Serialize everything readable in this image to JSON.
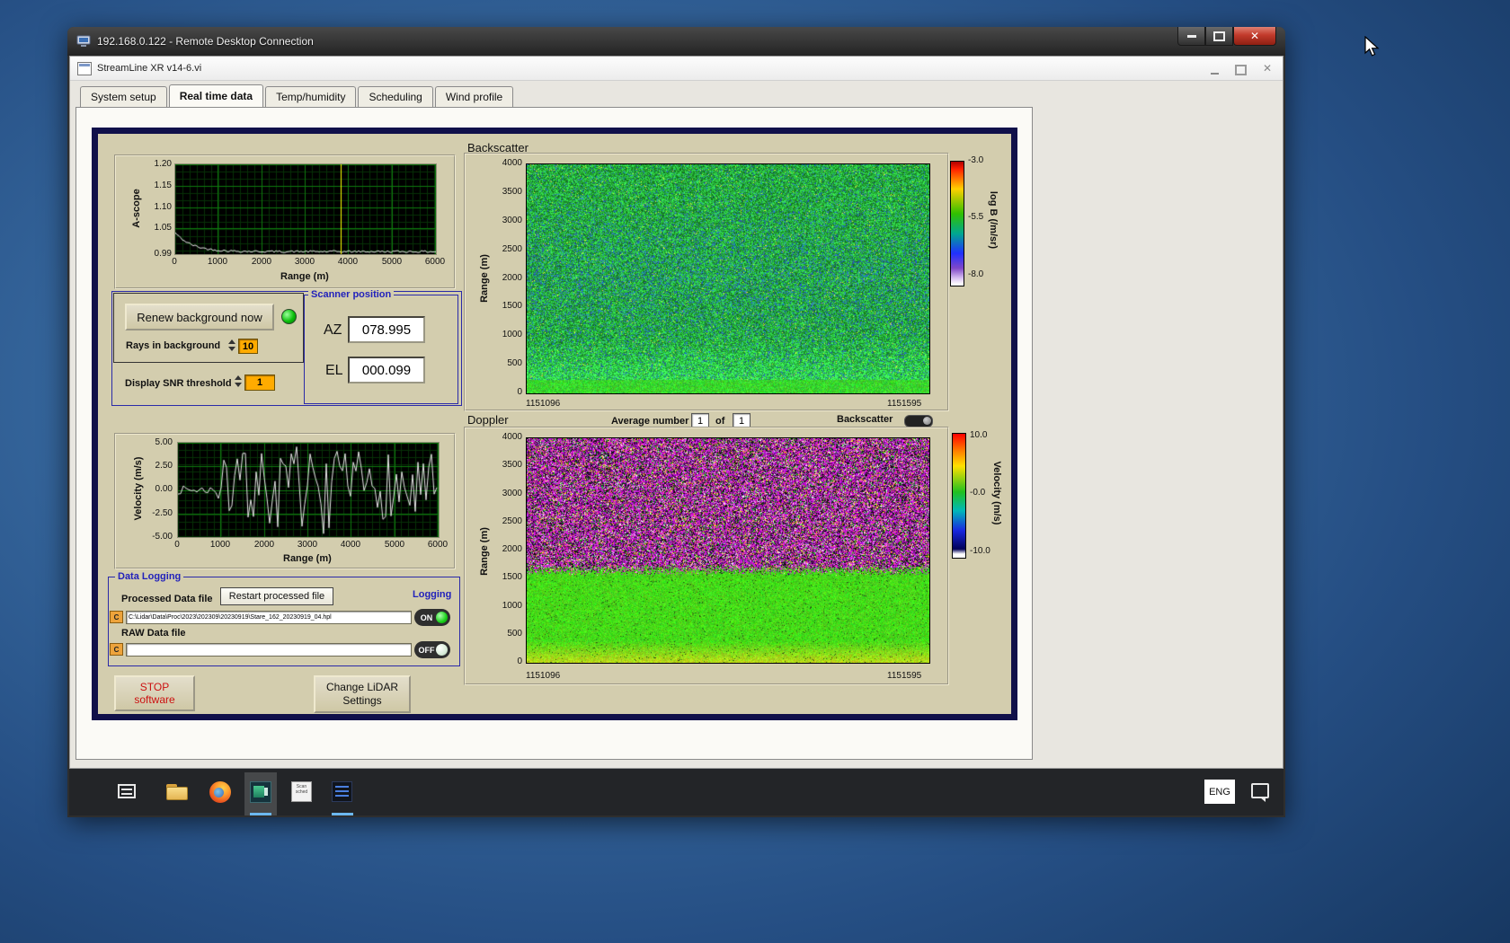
{
  "rdp": {
    "title": "192.168.0.122 - Remote Desktop Connection"
  },
  "app": {
    "title": "StreamLine XR v14-6.vi",
    "active_tab": "Real time data",
    "tabs": [
      {
        "label": "System setup"
      },
      {
        "label": "Real time data"
      },
      {
        "label": "Temp/humidity"
      },
      {
        "label": "Scheduling"
      },
      {
        "label": "Wind profile"
      }
    ]
  },
  "panel": {
    "controls": {
      "renew_button": "Renew background now",
      "rays_label": "Rays in background",
      "rays_value": "10",
      "snr_label": "Display SNR threshold",
      "snr_value": "1"
    },
    "scanner": {
      "title": "Scanner position",
      "az_label": "AZ",
      "az_value": "078.995",
      "el_label": "EL",
      "el_value": "000.099"
    },
    "doppler_bar": {
      "average_label": "Average number",
      "average_value": "1",
      "of_label": "of",
      "total_value": "1",
      "toggle_label": "Backscatter"
    },
    "logging": {
      "title": "Data Logging",
      "processed_label": "Processed Data file",
      "restart_button": "Restart processed file",
      "logging_label": "Logging",
      "drive_letter": "C",
      "processed_path": "C:\\Lidar\\Data\\Proc\\2023\\202309\\20230919\\Stare_162_20230919_04.hpl",
      "processed_toggle": "ON",
      "raw_label": "RAW Data file",
      "raw_path": "",
      "raw_toggle": "OFF"
    },
    "stop_button_line1": "STOP",
    "stop_button_line2": "software",
    "change_button_line1": "Change LiDAR",
    "change_button_line2": "Settings"
  },
  "taskbar": {
    "language": "ENG",
    "icons": [
      "task-view-icon",
      "file-explorer-icon",
      "firefox-icon",
      "remote-app-icon",
      "scan-scheduler-icon",
      "document-list-icon",
      "language-indicator",
      "notification-icon"
    ]
  },
  "chart_data": [
    {
      "id": "ascope",
      "type": "line",
      "ylabel": "A-scope",
      "xlabel": "Range (m)",
      "xlim": [
        0,
        6000
      ],
      "ylim": [
        0.99,
        1.2
      ],
      "xticks": [
        "0",
        "1000",
        "2000",
        "3000",
        "4000",
        "5000",
        "6000"
      ],
      "yticks": [
        "1.20",
        "1.15",
        "1.10",
        "1.05",
        "0.99"
      ],
      "cursor_x": 3800,
      "description": "white intensity trace decaying from ~1.04 at range 0 to flat ~0.995; yellow cursor line near 3800 m; dense green grid on black"
    },
    {
      "id": "velocity",
      "type": "line",
      "ylabel": "Velocity (m/s)",
      "xlabel": "Range (m)",
      "xlim": [
        0,
        6000
      ],
      "ylim": [
        -5,
        5
      ],
      "xticks": [
        "0",
        "1000",
        "2000",
        "3000",
        "4000",
        "5000",
        "6000"
      ],
      "yticks": [
        "5.00",
        "2.50",
        "0.00",
        "-2.50",
        "-5.00"
      ],
      "description": "near-zero velocity out to ~900 m, then full-scale random noise between -5 and +5 m/s to 6000 m"
    },
    {
      "id": "backscatter_heatmap",
      "type": "heatmap",
      "title": "Backscatter",
      "ylabel": "Range (m)",
      "ylim": [
        0,
        4000
      ],
      "yticks": [
        "4000",
        "3500",
        "3000",
        "2500",
        "2000",
        "1500",
        "1000",
        "500",
        "0"
      ],
      "x_start_label": "1151096",
      "x_end_label": "1151595",
      "colorbar": {
        "label": "log B (/m/sr)",
        "ticks": [
          "-3.0",
          "-5.5",
          "-8.0"
        ]
      },
      "description": "speckled green/cyan backscatter noise over time, brighter solid green near 0 m range"
    },
    {
      "id": "doppler_heatmap",
      "type": "heatmap",
      "title": "Doppler",
      "ylabel": "Range (m)",
      "ylim": [
        0,
        4000
      ],
      "yticks": [
        "4000",
        "3500",
        "3000",
        "2500",
        "2000",
        "1500",
        "1000",
        "500",
        "0"
      ],
      "x_start_label": "1151096",
      "x_end_label": "1151595",
      "colorbar": {
        "label": "Velocity (m/s)",
        "ticks": [
          "10.0",
          "-0.0",
          "-10.0"
        ]
      },
      "description": "magenta/black random velocity noise above ~1600 m, solid bright green (near-zero velocity) below"
    }
  ]
}
